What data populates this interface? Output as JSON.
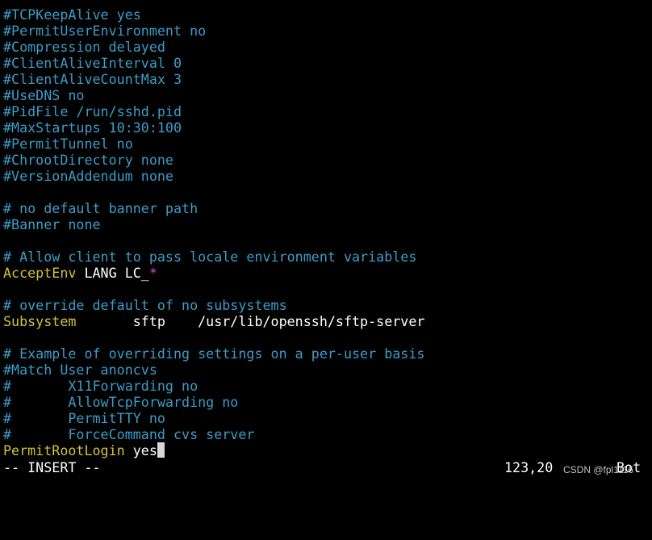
{
  "lines": [
    {
      "type": "comment",
      "text": "#TCPKeepAlive yes"
    },
    {
      "type": "comment",
      "text": "#PermitUserEnvironment no"
    },
    {
      "type": "comment",
      "text": "#Compression delayed"
    },
    {
      "type": "comment",
      "text": "#ClientAliveInterval 0"
    },
    {
      "type": "comment",
      "text": "#ClientAliveCountMax 3"
    },
    {
      "type": "comment",
      "text": "#UseDNS no"
    },
    {
      "type": "comment",
      "text": "#PidFile /run/sshd.pid"
    },
    {
      "type": "comment",
      "text": "#MaxStartups 10:30:100"
    },
    {
      "type": "comment",
      "text": "#PermitTunnel no"
    },
    {
      "type": "comment",
      "text": "#ChrootDirectory none"
    },
    {
      "type": "comment",
      "text": "#VersionAddendum none"
    },
    {
      "type": "blank",
      "text": ""
    },
    {
      "type": "comment",
      "text": "# no default banner path"
    },
    {
      "type": "comment",
      "text": "#Banner none"
    },
    {
      "type": "blank",
      "text": ""
    },
    {
      "type": "comment",
      "text": "# Allow client to pass locale environment variables"
    },
    {
      "type": "acceptenv",
      "keyword": "AcceptEnv",
      "value": " LANG LC_",
      "wildcard": "*"
    },
    {
      "type": "blank",
      "text": ""
    },
    {
      "type": "comment",
      "text": "# override default of no subsystems"
    },
    {
      "type": "directive",
      "keyword": "Subsystem",
      "value": "       sftp    /usr/lib/openssh/sftp-server"
    },
    {
      "type": "blank",
      "text": ""
    },
    {
      "type": "comment",
      "text": "# Example of overriding settings on a per-user basis"
    },
    {
      "type": "comment",
      "text": "#Match User anoncvs"
    },
    {
      "type": "comment",
      "text": "#       X11Forwarding no"
    },
    {
      "type": "comment",
      "text": "#       AllowTcpForwarding no"
    },
    {
      "type": "comment",
      "text": "#       PermitTTY no"
    },
    {
      "type": "comment",
      "text": "#       ForceCommand cvs server"
    },
    {
      "type": "cursorline",
      "keyword": "PermitRootLogin",
      "value": " yes"
    }
  ],
  "status": {
    "mode": "-- INSERT --",
    "position": "123,20",
    "scroll": "Bot"
  },
  "watermark": "CSDN @fpl1116",
  "colors": {
    "comment": "#3b9dc9",
    "keyword": "#d2c23a",
    "text": "#ffffff",
    "wildcard": "#d050d0",
    "background": "#000000"
  }
}
